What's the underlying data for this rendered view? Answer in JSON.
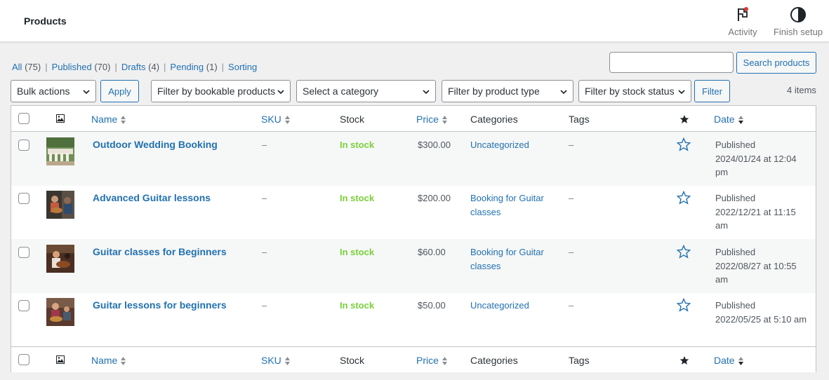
{
  "header": {
    "title": "Products",
    "activity_label": "Activity",
    "finish_setup_label": "Finish setup"
  },
  "views": [
    {
      "label": "All",
      "count": "(75)"
    },
    {
      "label": "Published",
      "count": "(70)"
    },
    {
      "label": "Drafts",
      "count": "(4)"
    },
    {
      "label": "Pending",
      "count": "(1)"
    },
    {
      "label": "Sorting",
      "count": ""
    }
  ],
  "search": {
    "placeholder": "",
    "button_label": "Search products"
  },
  "filters": {
    "bulk_actions": "Bulk actions",
    "apply_label": "Apply",
    "bookable": "Filter by bookable products",
    "category": "Select a category",
    "product_type": "Filter by product type",
    "stock_status": "Filter by stock status",
    "filter_label": "Filter"
  },
  "items_count": "4 items",
  "columns": {
    "name": "Name",
    "sku": "SKU",
    "stock": "Stock",
    "price": "Price",
    "categories": "Categories",
    "tags": "Tags",
    "date": "Date"
  },
  "rows": [
    {
      "name": "Outdoor Wedding Booking",
      "sku": "–",
      "stock": "In stock",
      "price": "$300.00",
      "categories": [
        "Uncategorized"
      ],
      "tags": "–",
      "date_status": "Published",
      "date_value": "2024/01/24 at 12:04 pm"
    },
    {
      "name": "Advanced Guitar lessons",
      "sku": "–",
      "stock": "In stock",
      "price": "$200.00",
      "categories": [
        "Booking for Guitar classes"
      ],
      "tags": "–",
      "date_status": "Published",
      "date_value": "2022/12/21 at 11:15 am"
    },
    {
      "name": "Guitar classes for Beginners",
      "sku": "–",
      "stock": "In stock",
      "price": "$60.00",
      "categories": [
        "Booking for Guitar classes"
      ],
      "tags": "–",
      "date_status": "Published",
      "date_value": "2022/08/27 at 10:55 am"
    },
    {
      "name": "Guitar lessons for beginners",
      "sku": "–",
      "stock": "In stock",
      "price": "$50.00",
      "categories": [
        "Uncategorized"
      ],
      "tags": "–",
      "date_status": "Published",
      "date_value": "2022/05/25 at 5:10 am"
    }
  ],
  "colors": {
    "link": "#2271b1",
    "in_stock": "#7ad03a",
    "background": "#f0f0f1"
  }
}
